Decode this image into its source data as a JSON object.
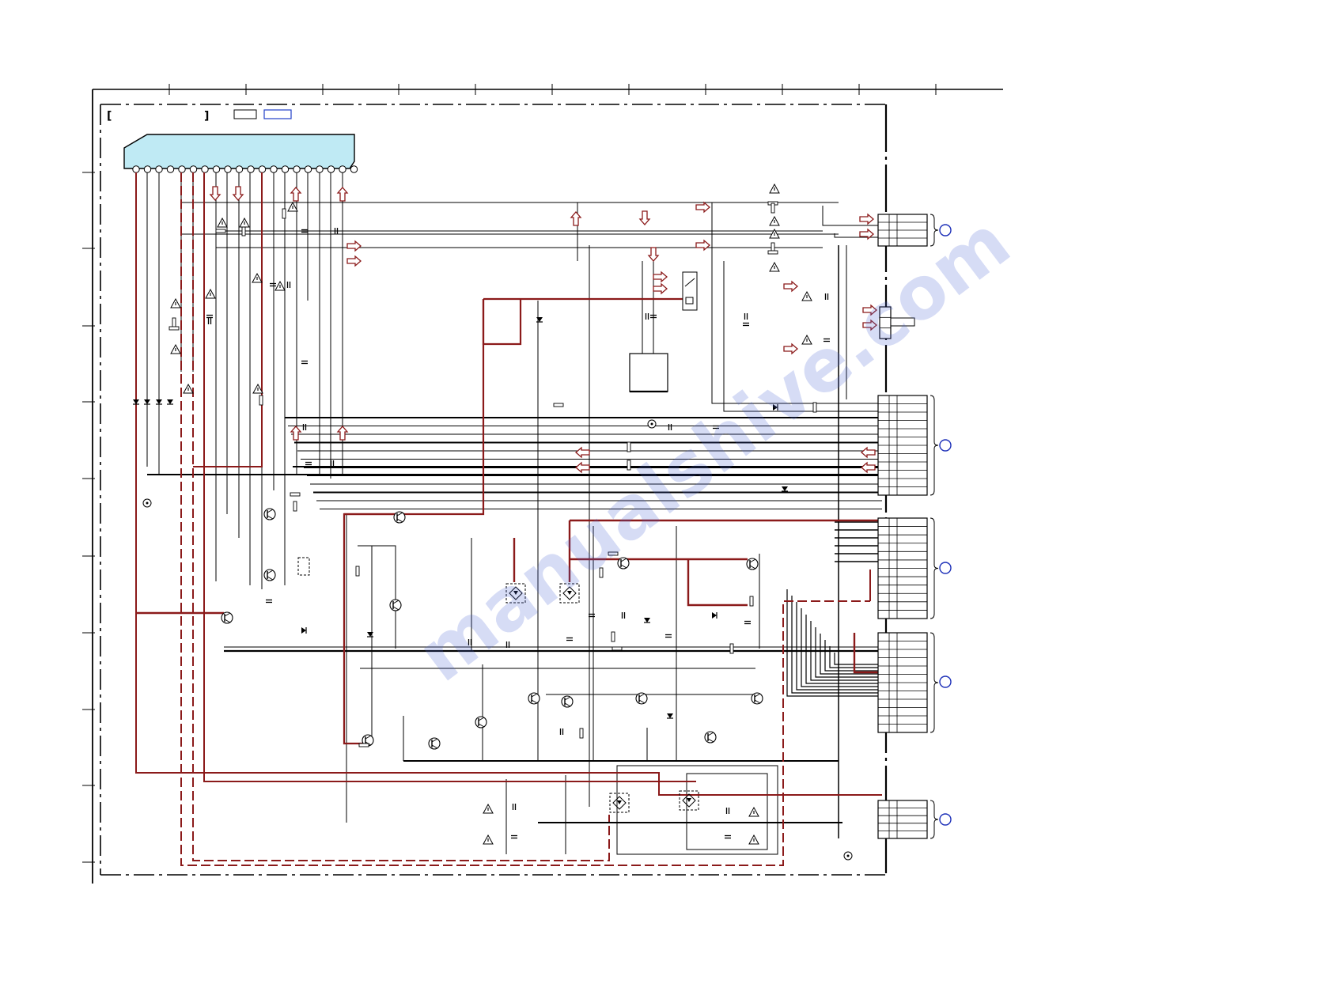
{
  "watermark": {
    "text": "manualshive.com"
  },
  "colors": {
    "wire": "#000000",
    "power_wire": "#8b1a1a",
    "header_fill": "#bfeaf4",
    "connector_marker": "#1c2fb8",
    "legend_box": "#2140c8",
    "warning": "#000000"
  },
  "legend": {
    "items": [
      "box-black",
      "box-blue"
    ]
  },
  "connectors": [
    {
      "id": "cn-top",
      "pins": 4
    },
    {
      "id": "cn-aux",
      "pins": 3
    },
    {
      "id": "cn-mid",
      "pins": 12
    },
    {
      "id": "cn-lower-a",
      "pins": 12
    },
    {
      "id": "cn-lower-b",
      "pins": 12
    },
    {
      "id": "cn-bottom",
      "pins": 5
    }
  ],
  "icons": [
    "warning-triangle-icon",
    "diode-icon",
    "transistor-icon",
    "capacitor-icon",
    "resistor-icon",
    "arrow-icon",
    "ground-icon",
    "bridge-rectifier-icon",
    "relay-icon"
  ]
}
